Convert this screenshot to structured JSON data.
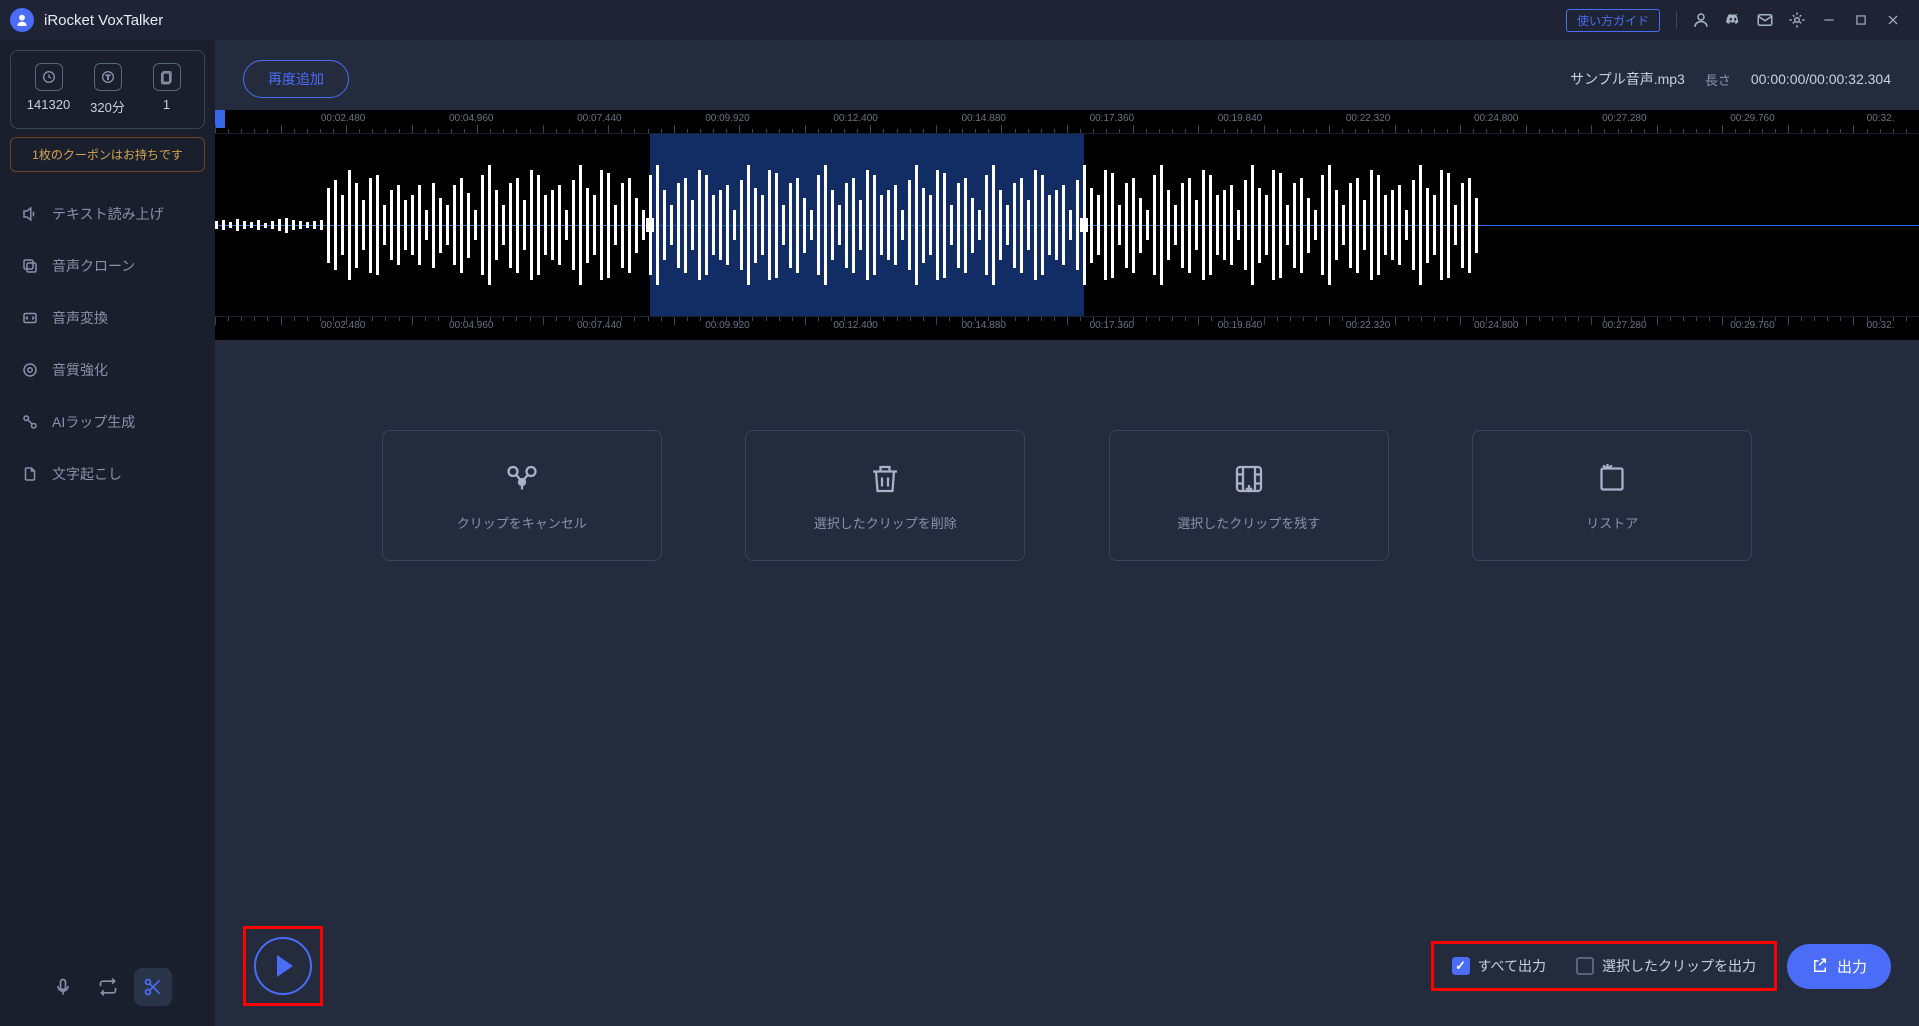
{
  "app": {
    "title": "iRocket VoxTalker",
    "guide_button": "使い方ガイド"
  },
  "stats": {
    "words": "141320",
    "minutes": "320分",
    "licenses": "1"
  },
  "coupon": {
    "text": "1枚のクーポンはお持ちです"
  },
  "nav": {
    "tts": "テキスト読み上げ",
    "clone": "音声クローン",
    "convert": "音声変換",
    "enhance": "音質強化",
    "rap": "AIラップ生成",
    "transcribe": "文字起こし"
  },
  "toolbar": {
    "readd": "再度追加"
  },
  "file": {
    "name": "サンプル音声.mp3",
    "length_label": "長さ",
    "time": "00:00:00/00:00:32.304"
  },
  "ruler_top": [
    "00:02.480",
    "00:04.960",
    "00:07.440",
    "00:09.920",
    "00:12.400",
    "00:14.880",
    "00:17.360",
    "00:19.840",
    "00:22.320",
    "00:24.800",
    "00:27.280",
    "00:29.760",
    "00:32."
  ],
  "ruler_bottom": [
    "00:02.480",
    "00:04.960",
    "00:07.440",
    "00:09.920",
    "00:12.400",
    "00:14.880",
    "00:17.360",
    "00:19.840",
    "00:22.320",
    "00:24.800",
    "00:27.280",
    "00:29.760",
    "00:32."
  ],
  "actions": {
    "cancel": "クリップをキャンセル",
    "delete": "選択したクリップを削除",
    "keep": "選択したクリップを残す",
    "restore": "リストア"
  },
  "export": {
    "all": "すべて出力",
    "selected": "選択したクリップを出力",
    "button": "出力"
  },
  "selection": {
    "start_pct": 25.5,
    "end_pct": 51.0
  },
  "wave_heights": [
    8,
    10,
    6,
    12,
    8,
    6,
    10,
    5,
    8,
    12,
    15,
    10,
    8,
    6,
    8,
    10,
    75,
    90,
    60,
    110,
    85,
    50,
    95,
    100,
    40,
    70,
    80,
    50,
    60,
    80,
    30,
    85,
    55,
    40,
    80,
    95,
    65,
    30,
    100,
    120,
    70,
    40,
    85,
    95,
    50,
    110,
    100,
    60,
    70,
    80,
    30,
    90,
    120,
    75,
    60,
    110,
    105,
    40,
    85,
    95,
    55,
    30,
    100,
    120,
    70,
    40,
    85,
    95,
    50,
    110,
    100,
    60,
    70,
    80,
    30,
    90,
    120,
    75,
    60,
    110,
    105,
    40,
    85,
    95,
    55,
    30,
    100,
    120,
    70,
    40,
    85,
    95,
    50,
    110,
    100,
    60,
    70,
    80,
    30,
    90,
    120,
    75,
    60,
    110,
    105,
    40,
    85,
    95,
    55,
    30,
    100,
    120,
    70,
    40,
    85,
    95,
    50,
    110,
    100,
    60,
    70,
    80,
    30,
    90,
    120,
    75,
    60,
    110,
    105,
    40,
    85,
    95,
    55,
    30,
    100,
    120,
    70,
    40,
    85,
    95,
    50,
    110,
    100,
    60,
    70,
    80,
    30,
    90,
    120,
    75,
    60,
    110,
    105,
    40,
    85,
    95,
    55,
    30,
    100,
    120,
    70,
    40,
    85,
    95,
    50,
    110,
    100,
    60,
    70,
    80,
    30,
    90,
    120,
    75,
    60,
    110,
    105,
    40,
    85,
    95,
    55
  ]
}
